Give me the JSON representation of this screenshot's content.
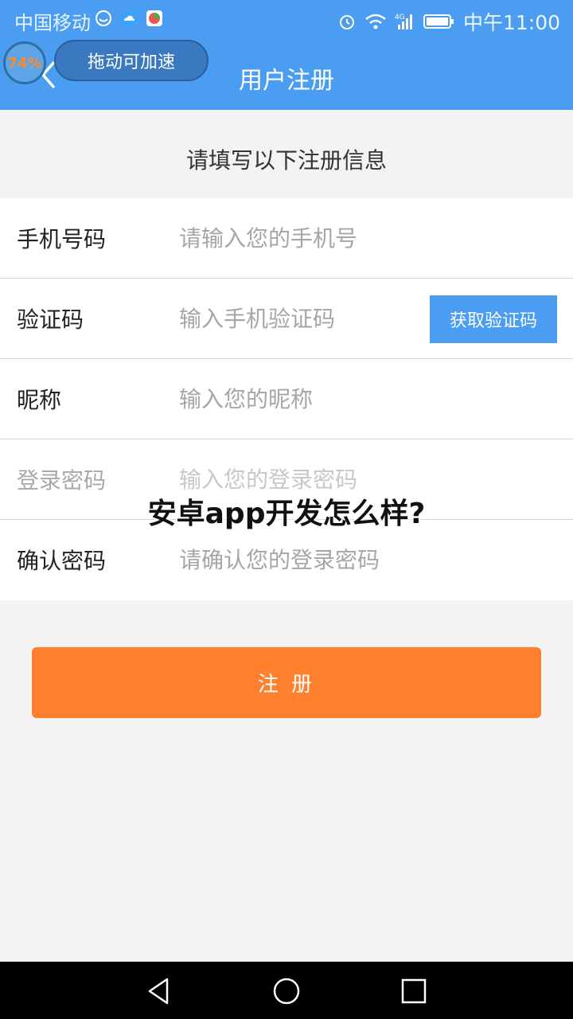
{
  "status_bar": {
    "carrier": "中国移动",
    "time": "中午11:00",
    "network": "4G"
  },
  "header": {
    "title": "用户注册",
    "float_ball_percent": "74%",
    "speed_label": "拖动可加速"
  },
  "form": {
    "heading": "请填写以下注册信息",
    "fields": [
      {
        "label": "手机号码",
        "placeholder": "请输入您的手机号"
      },
      {
        "label": "验证码",
        "placeholder": "输入手机验证码",
        "action_label": "获取验证码"
      },
      {
        "label": "昵称",
        "placeholder": "输入您的昵称"
      },
      {
        "label": "登录密码",
        "placeholder": "输入您的登录密码"
      },
      {
        "label": "确认密码",
        "placeholder": "请确认您的登录密码"
      }
    ],
    "submit_label": "注 册"
  },
  "overlay": {
    "caption": "安卓app开发怎么样?"
  },
  "colors": {
    "header": "#4a9df0",
    "submit": "#ff8130",
    "background": "#f3f3f3"
  },
  "icons": [
    "alarm-icon",
    "wifi-icon",
    "signal-icon",
    "battery-icon",
    "back-icon",
    "nav-back-icon",
    "nav-home-icon",
    "nav-recents-icon"
  ]
}
